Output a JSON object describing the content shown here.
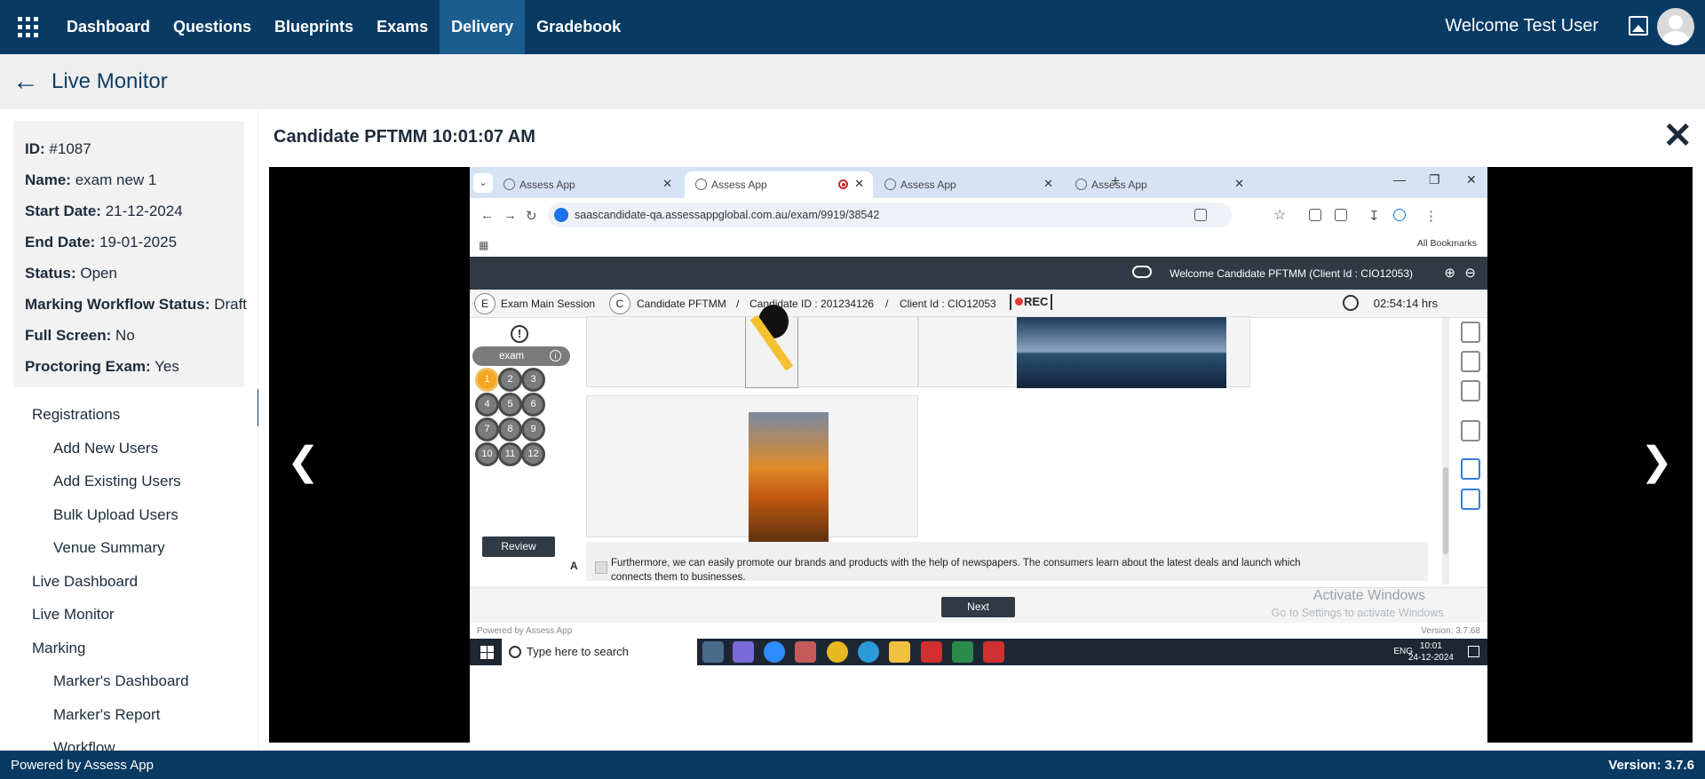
{
  "topnav": {
    "items": [
      "Dashboard",
      "Questions",
      "Blueprints",
      "Exams",
      "Delivery",
      "Gradebook"
    ],
    "active": "Delivery",
    "welcome": "Welcome Test User"
  },
  "page": {
    "title": "Live Monitor"
  },
  "info": {
    "id_label": "ID:",
    "id_value": "#1087",
    "name_label": "Name:",
    "name_value": "exam new 1",
    "start_label": "Start Date:",
    "start_value": "21-12-2024",
    "end_label": "End Date:",
    "end_value": "19-01-2025",
    "status_label": "Status:",
    "status_value": "Open",
    "workflow_label": "Marking Workflow Status:",
    "workflow_value": "Draft",
    "fullscreen_label": "Full Screen:",
    "fullscreen_value": "No",
    "proctoring_label": "Proctoring Exam:",
    "proctoring_value": "Yes"
  },
  "sidebar": {
    "menu": [
      "Registrations",
      "Add New Users",
      "Add Existing Users",
      "Bulk Upload Users",
      "Venue Summary",
      "Live Dashboard",
      "Live Monitor",
      "Marking",
      "Marker's Dashboard",
      "Marker's Report",
      "Workflow"
    ]
  },
  "panel": {
    "title": "Candidate PFTMM 10:01:07 AM"
  },
  "browser": {
    "tabs": [
      "Assess App",
      "Assess App",
      "Assess App",
      "Assess App"
    ],
    "url": "saascandidate-qa.assessappglobal.com.au/exam/9919/38542",
    "bookmarks": "All Bookmarks"
  },
  "exam": {
    "welcome": "Welcome Candidate PFTMM (Client Id : CIO12053)",
    "session_badge": "E",
    "session": "Exam Main Session",
    "candidate_badge": "C",
    "candidate": "Candidate PFTMM",
    "sep": "/",
    "candidate_id": "Candidate ID : 201234126",
    "client_id": "Client Id : CIO12053",
    "rec": "REC",
    "timer": "02:54:14 hrs",
    "warn": "!",
    "section": "exam",
    "info": "i",
    "questions": [
      "1",
      "2",
      "3",
      "4",
      "5",
      "6",
      "7",
      "8",
      "9",
      "10",
      "11",
      "12"
    ],
    "current_question": "1",
    "review": "Review",
    "answer_letter": "A",
    "answer_text": "Furthermore, we can easily promote our brands and products with the help of newspapers. The consumers learn about the latest deals and launch which connects them to businesses.",
    "next": "Next",
    "activate1": "Activate Windows",
    "activate2": "Go to Settings to activate Windows.",
    "powered": "Powered by Assess App",
    "version": "Version: 3.7.68"
  },
  "taskbar": {
    "search": "Type here to search",
    "lang": "ENG",
    "time": "10:01",
    "date": "24-12-2024"
  },
  "footer": {
    "powered": "Powered by Assess App",
    "version": "Version: 3.7.6"
  }
}
